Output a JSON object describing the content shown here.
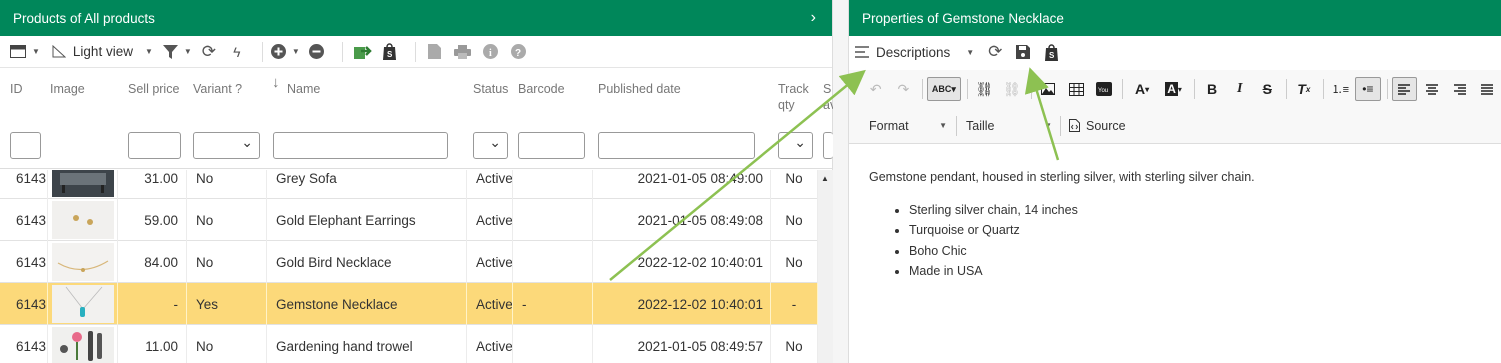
{
  "left_panel": {
    "title": "Products of All products",
    "toolbar": {
      "view_label": "Light view"
    },
    "columns": {
      "id": "ID",
      "image": "Image",
      "sell_price": "Sell price",
      "variant": "Variant ?",
      "name": "Name",
      "status": "Status",
      "barcode": "Barcode",
      "published_date": "Published date",
      "track_qty_1": "Track",
      "track_qty_2": "qty",
      "stock_1": "S",
      "stock_2": "av"
    },
    "rows": [
      {
        "id": "6143",
        "price": "31.00",
        "variant": "No",
        "name": "Grey Sofa",
        "status": "Active",
        "barcode": "",
        "date": "2021-01-05 08:49:00",
        "track": "No"
      },
      {
        "id": "6143",
        "price": "59.00",
        "variant": "No",
        "name": "Gold Elephant Earrings",
        "status": "Active",
        "barcode": "",
        "date": "2021-01-05 08:49:08",
        "track": "No"
      },
      {
        "id": "6143",
        "price": "84.00",
        "variant": "No",
        "name": "Gold Bird Necklace",
        "status": "Active",
        "barcode": "",
        "date": "2022-12-02 10:40:01",
        "track": "No"
      },
      {
        "id": "6143",
        "price": "-",
        "variant": "Yes",
        "name": "Gemstone Necklace",
        "status": "Active",
        "barcode": "-",
        "date": "2022-12-02 10:40:01",
        "track": "-"
      },
      {
        "id": "6143",
        "price": "11.00",
        "variant": "No",
        "name": "Gardening hand trowel",
        "status": "Active",
        "barcode": "",
        "date": "2021-01-05 08:49:57",
        "track": "No"
      }
    ]
  },
  "right_panel": {
    "title": "Properties of Gemstone Necklace",
    "descriptions_label": "Descriptions",
    "format_label": "Format",
    "size_label": "Taille",
    "source_label": "Source",
    "description": {
      "intro": "Gemstone pendant, housed in sterling silver, with sterling silver chain.",
      "bullets": [
        "Sterling silver chain, 14 inches",
        "Turquoise or Quartz",
        "Boho Chic",
        "Made in USA"
      ]
    }
  },
  "colors": {
    "title_bar": "#00875a",
    "selected_row": "#fcd97a",
    "annotation_arrow": "#8dc152"
  }
}
